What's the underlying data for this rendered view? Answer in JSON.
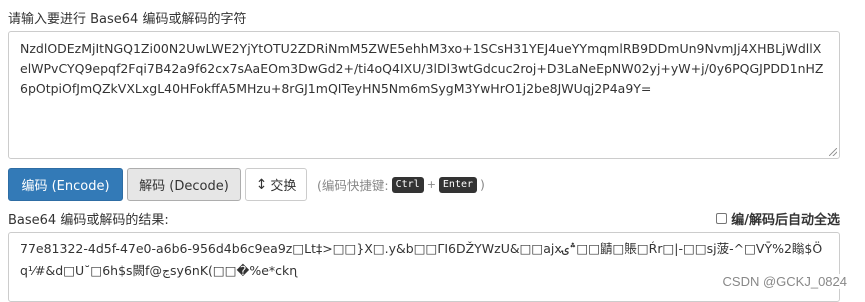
{
  "input": {
    "label": "请输入要进行 Base64 编码或解码的字符",
    "value": "NzdlODEzMjItNGQ1Zi00N2UwLWE2YjYtOTU2ZDRiNmM5ZWE5ehhM3xo+1SCsH31YEJ4ueYYmqmlRB9DDmUn9NvmJj4XHBLjWdllXelWPvCYQ9epqf2Fqi7B42a9f62cx7sAaEOm3DwGd2+/ti4oQ4IXU/3lDl3wtGdcuc2roj+D3LaNeEpNW02yj+yW+j/0y6PQGJPDD1nHZ6pOtpiOfJmQZkVXLxgL40HFokffA5MHzu+8rGJ1mQITeyHN5Nm6mSygM3YwHrO1j2be8JWUqj2P4a9Y="
  },
  "toolbar": {
    "encode_label": "编码 (Encode)",
    "decode_label": "解码 (Decode)",
    "swap_icon": "↕",
    "swap_label": "交换",
    "shortcut_prefix": "(编码快捷键:",
    "key_ctrl": "Ctrl",
    "key_plus": "+",
    "key_enter": "Enter",
    "shortcut_suffix": ")"
  },
  "result": {
    "label": "Base64 编码或解码的结果:",
    "auto_select_label": "编/解码后自动全选",
    "auto_select_checked": false,
    "value": "77e81322-4d5f-47e0-a6b6-956d4b6c9ea9z□Lt‡>□□}X□.y&b□□ΓI6DŽYWzU&□□ajx؞ۍ□□鼱□ؙ賬□Ŕr□|-□□sj菠-^□VȲ%2瞈$Öq¹⁄#&d□U˘□6h$s闕f@ڃsy6nK(□□�%e*ckɳ"
  },
  "watermark": "CSDN @GCKJ_0824"
}
